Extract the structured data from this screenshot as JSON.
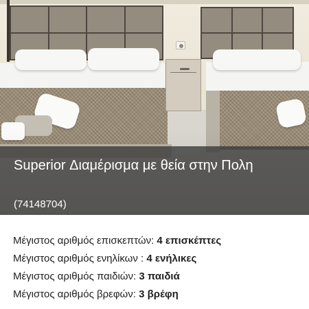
{
  "listing": {
    "title": "Superior Διαμέρισμα με θεία στην Πολη",
    "code": "(74148704)"
  },
  "details": [
    {
      "label": "Μέγιστος αριθμός επισκεπτών:",
      "value": "4 επισκέπτες"
    },
    {
      "label": "Μέγιστος αριθμός ενηλίκων :",
      "value": "4 ενήλικες"
    },
    {
      "label": "Μέγιστος αριθμός παιδιών:",
      "value": "3 παιδιά"
    },
    {
      "label": "Μέγιστος αριθμός βρεφών:",
      "value": "3 βρέφη"
    }
  ]
}
